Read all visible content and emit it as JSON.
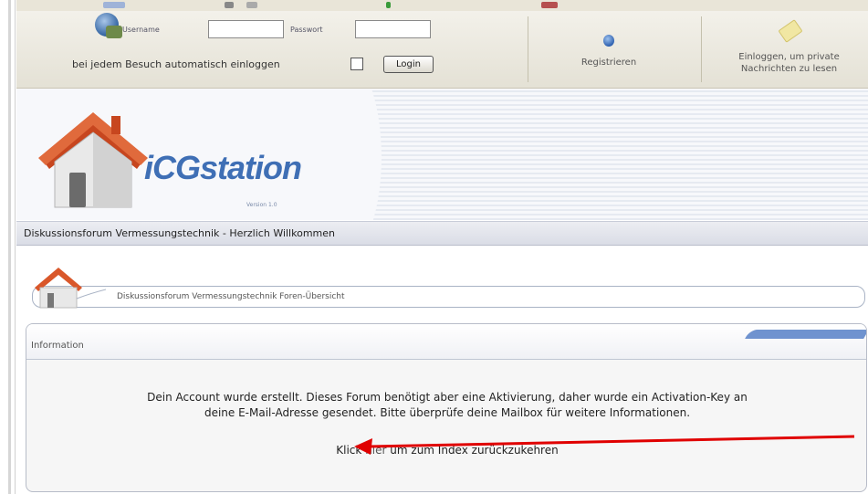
{
  "login": {
    "username_label": "Username",
    "password_label": "Passwort",
    "username_value": "",
    "password_value": "",
    "auto_login_label": "bei jedem Besuch automatisch einloggen",
    "login_button": "Login",
    "register_link": "Registrieren",
    "private_messages_link_line1": "Einloggen, um private",
    "private_messages_link_line2": "Nachrichten zu lesen"
  },
  "header": {
    "logo_text": "iCGstation",
    "version": "Version 1.0"
  },
  "welcome_bar": "Diskussionsforum Vermessungstechnik - Herzlich Willkommen",
  "breadcrumb": "Diskussionsforum Vermessungstechnik Foren-Übersicht",
  "information": {
    "title": "Information",
    "message_line1": "Dein Account wurde erstellt. Dieses Forum benötigt aber eine Aktivierung, daher wurde ein Activation-Key an",
    "message_line2": "deine E-Mail-Adresse gesendet. Bitte überprüfe deine Mailbox für weitere Informationen.",
    "back_prefix": "Klick",
    "back_link": "hier",
    "back_suffix": "um zum Index zurückzukehren"
  },
  "colors": {
    "logo_blue": "#3f6fb5",
    "roof_orange": "#d9572a",
    "annotation_arrow": "#e00000"
  },
  "icons": {
    "login": "user-globe-icon",
    "register": "globe-icon",
    "private_messages": "note-icon",
    "logo": "house-icon"
  }
}
